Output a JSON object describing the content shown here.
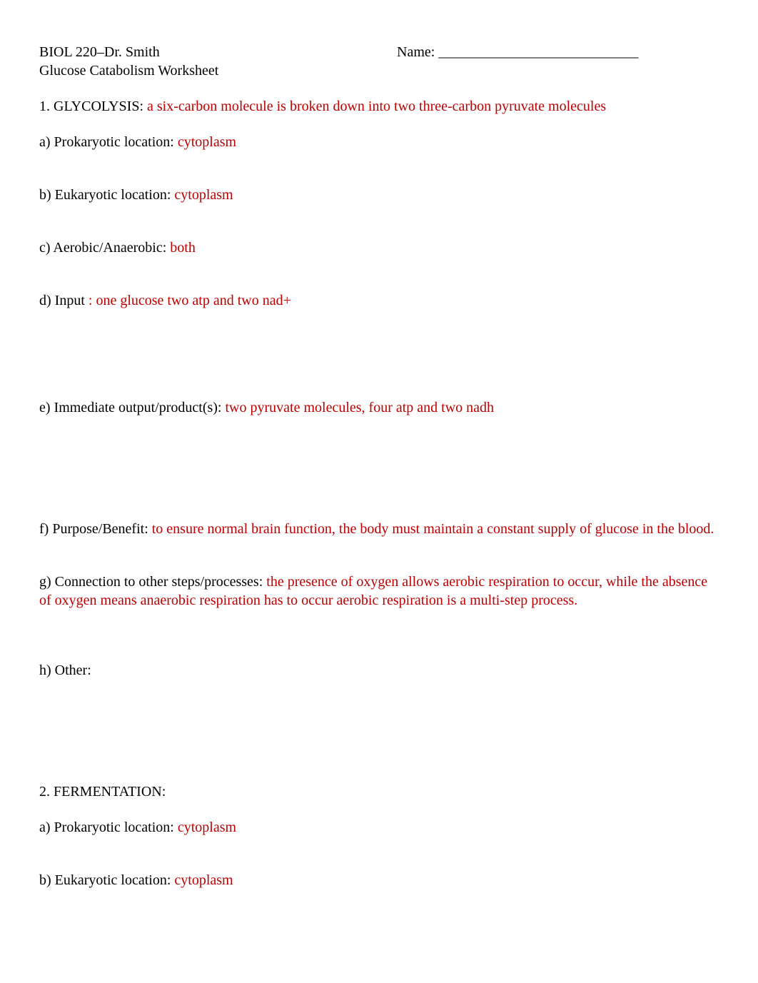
{
  "header": {
    "course": "BIOL 220–Dr. Smith",
    "name_label": "Name:",
    "name_blank": " ____________________________",
    "subtitle": "Glucose Catabolism Worksheet"
  },
  "q1": {
    "title": "1. GLYCOLYSIS:",
    "title_answer": "   a six-carbon molecule is broken down into two three-carbon pyruvate molecules",
    "a_label": "a) Prokaryotic location:",
    "a_answer": "      cytoplasm",
    "b_label": "b) Eukaryotic location:",
    "b_answer": "     cytoplasm",
    "c_label": "c) Aerobic/Anaerobic:",
    "c_answer": "      both",
    "d_label": "d) Input",
    "d_answer": "  : one glucose two atp and two nad+",
    "e_label": "e) Immediate output/product(s):",
    "e_answer": "         two pyruvate molecules, four atp and two nadh",
    "f_label": "f) Purpose/Benefit:",
    "f_answer": "      to ensure normal brain function, the body must maintain a constant supply of glucose in the blood.",
    "g_label": "g) Connection to other steps/processes:",
    "g_answer": "           the presence of oxygen allows aerobic respiration to occur, while the absence of oxygen means anaerobic respiration has to occur aerobic respiration is a multi-step process.",
    "h_label": "h) Other:"
  },
  "q2": {
    "title": "2. FERMENTATION:",
    "a_label": "a) Prokaryotic location:",
    "a_answer": "      cytoplasm",
    "b_label": "b) Eukaryotic location:",
    "b_answer": "     cytoplasm"
  }
}
